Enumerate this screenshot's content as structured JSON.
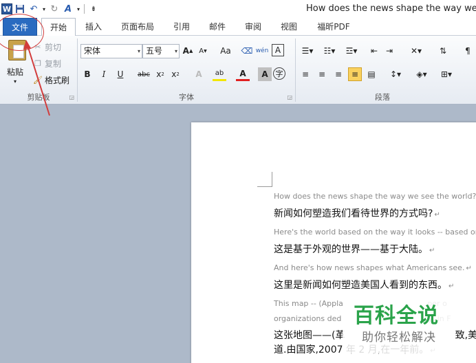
{
  "window": {
    "app_icon": "W",
    "title": "How does the news shape the way we see"
  },
  "tabs": [
    {
      "label": "文件"
    },
    {
      "label": "开始"
    },
    {
      "label": "插入"
    },
    {
      "label": "页面布局"
    },
    {
      "label": "引用"
    },
    {
      "label": "邮件"
    },
    {
      "label": "审阅"
    },
    {
      "label": "视图"
    },
    {
      "label": "福昕PDF"
    }
  ],
  "clipboard": {
    "paste_label": "粘贴",
    "cut_label": "剪切",
    "copy_label": "复制",
    "format_painter_label": "格式刷",
    "group_label": "剪贴板"
  },
  "font": {
    "font_name": "宋体",
    "font_size": "五号",
    "group_label": "字体",
    "grow_glyph": "A",
    "shrink_glyph": "A",
    "case_glyph": "Aa",
    "pinyin_glyph": "wén",
    "border_glyph": "A",
    "bold_glyph": "B",
    "italic_glyph": "I",
    "underline_glyph": "U",
    "strike_glyph": "abc",
    "sub_glyph": "x",
    "sup_glyph": "x",
    "highlight_glyph": "ab",
    "color_glyph": "A",
    "shade_glyph": "A",
    "enclose_glyph": "字"
  },
  "paragraph": {
    "group_label": "段落"
  },
  "document": {
    "lines": [
      {
        "lang": "en",
        "text": "How does the news shape the way we see the world?"
      },
      {
        "lang": "zh",
        "text": "新闻如何塑造我们看待世界的方式吗?"
      },
      {
        "lang": "en",
        "text": "Here's the world based on the way it looks -- based on l"
      },
      {
        "lang": "zh",
        "text": "这是基于外观的世界——基于大陆。"
      },
      {
        "lang": "en",
        "text": "And here's how news shapes what Americans see."
      },
      {
        "lang": "zh",
        "text": "这里是新闻如何塑造美国人看到的东西。"
      },
      {
        "lang": "en",
        "text": "This map -- (Appla                                   per o"
      },
      {
        "lang": "en",
        "text": "organizations ded                                    y, in F"
      },
      {
        "lang": "zh",
        "text": "这张地图——(革                                    致,美"
      },
      {
        "lang": "zh",
        "text": "道.由国家,2007 年 2 月,在一年前。"
      }
    ],
    "paragraph_mark": "↵"
  },
  "watermark": {
    "title": "百科全说",
    "subtitle": "助你轻松解决"
  },
  "colors": {
    "file_tab": "#2a6bc0",
    "annotation": "#d23c3c",
    "watermark_green": "#2aa34a",
    "doc_background": "#adb9c9"
  }
}
